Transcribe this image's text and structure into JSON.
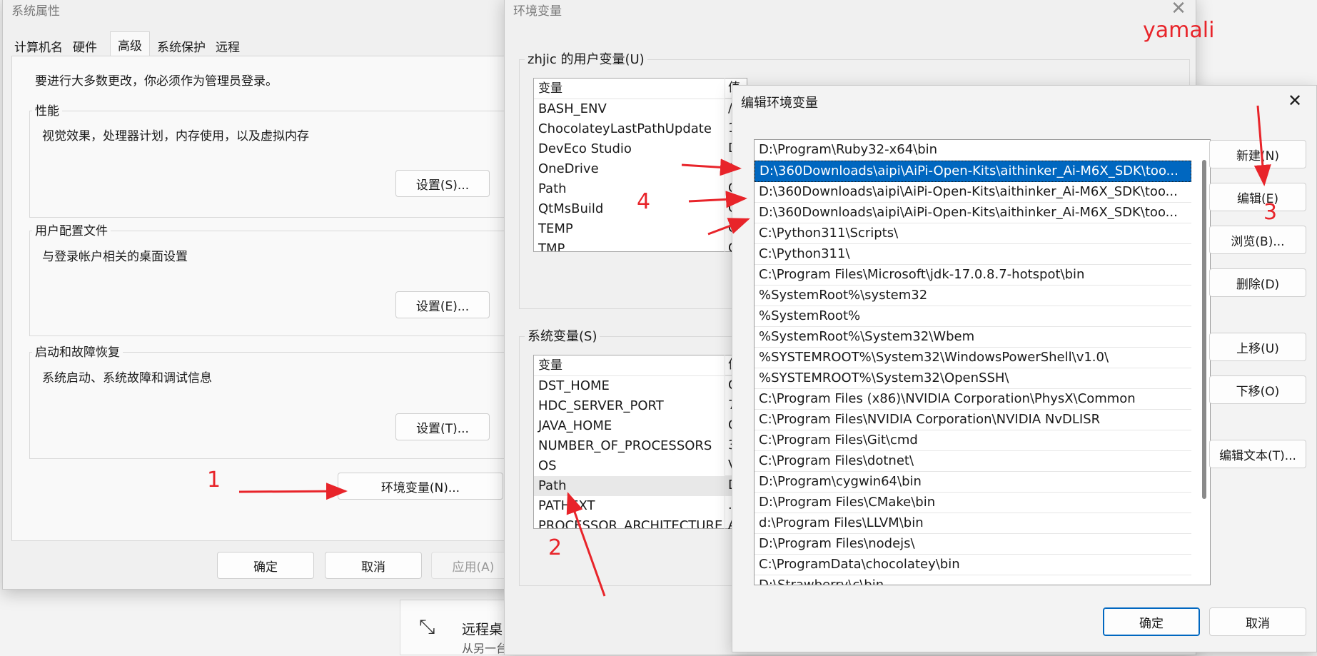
{
  "sysprops": {
    "title": "系统属性",
    "tabs": [
      "计算机名",
      "硬件",
      "高级",
      "系统保护",
      "远程"
    ],
    "admin_note": "要进行大多数更改，你必须作为管理员登录。",
    "perf": {
      "label": "性能",
      "desc": "视觉效果，处理器计划，内存使用，以及虚拟内存",
      "button": "设置(S)..."
    },
    "profile": {
      "label": "用户配置文件",
      "desc": "与登录帐户相关的桌面设置",
      "button": "设置(E)..."
    },
    "startup": {
      "label": "启动和故障恢复",
      "desc": "系统启动、系统故障和调试信息",
      "button": "设置(T)..."
    },
    "envvars_button": "环境变量(N)...",
    "ok": "确定",
    "cancel": "取消",
    "apply": "应用(A)"
  },
  "envvars": {
    "title": "环境变量",
    "user_group": "zhjic 的用户变量(U)",
    "user_header": "变量",
    "user_value_header_fragment": "值",
    "user_vars": [
      "BASH_ENV",
      "ChocolateyLastPathUpdate",
      "DevEco Studio",
      "OneDrive",
      "Path",
      "QtMsBuild",
      "TEMP",
      "TMP"
    ],
    "user_value_fragments": [
      "/",
      "1",
      "D",
      "C",
      "C",
      "C",
      "C",
      "C"
    ],
    "sys_group": "系统变量(S)",
    "sys_header": "变量",
    "sys_value_header_fragment": "值",
    "sys_vars": [
      "DST_HOME",
      "HDC_SERVER_PORT",
      "JAVA_HOME",
      "NUMBER_OF_PROCESSORS",
      "OS",
      "Path",
      "PATHEXT",
      "PROCESSOR_ARCHITECTURE"
    ],
    "sys_value_fragments": [
      "C",
      "7",
      "C",
      "3",
      "V",
      "D",
      ".",
      "A"
    ]
  },
  "edit": {
    "title": "编辑环境变量",
    "paths": [
      "D:\\Program\\Ruby32-x64\\bin",
      "D:\\360Downloads\\aipi\\AiPi-Open-Kits\\aithinker_Ai-M6X_SDK\\too...",
      "D:\\360Downloads\\aipi\\AiPi-Open-Kits\\aithinker_Ai-M6X_SDK\\too...",
      "D:\\360Downloads\\aipi\\AiPi-Open-Kits\\aithinker_Ai-M6X_SDK\\too...",
      "C:\\Python311\\Scripts\\",
      "C:\\Python311\\",
      "C:\\Program Files\\Microsoft\\jdk-17.0.8.7-hotspot\\bin",
      "%SystemRoot%\\system32",
      "%SystemRoot%",
      "%SystemRoot%\\System32\\Wbem",
      "%SYSTEMROOT%\\System32\\WindowsPowerShell\\v1.0\\",
      "%SYSTEMROOT%\\System32\\OpenSSH\\",
      "C:\\Program Files (x86)\\NVIDIA Corporation\\PhysX\\Common",
      "C:\\Program Files\\NVIDIA Corporation\\NVIDIA NvDLISR",
      "C:\\Program Files\\Git\\cmd",
      "C:\\Program Files\\dotnet\\",
      "D:\\Program\\cygwin64\\bin",
      "D:\\Program Files\\CMake\\bin",
      "d:\\Program Files\\LLVM\\bin",
      "D:\\Program Files\\nodejs\\",
      "C:\\ProgramData\\chocolatey\\bin",
      "D:\\Strawberry\\c\\bin"
    ],
    "buttons": {
      "new": "新建(N)",
      "edit": "编辑(E)",
      "browse": "浏览(B)...",
      "delete": "删除(D)",
      "up": "上移(U)",
      "down": "下移(O)",
      "edit_text": "编辑文本(T)..."
    },
    "ok": "确定",
    "cancel": "取消"
  },
  "remote_panel": {
    "title": "远程桌",
    "subtitle": "从另一台"
  },
  "annotations": {
    "watermark": "yamali",
    "n1": "1",
    "n2": "2",
    "n3": "3",
    "n4": "4"
  },
  "colors": {
    "accent": "#0067c0",
    "annotation": "#e8242a"
  }
}
